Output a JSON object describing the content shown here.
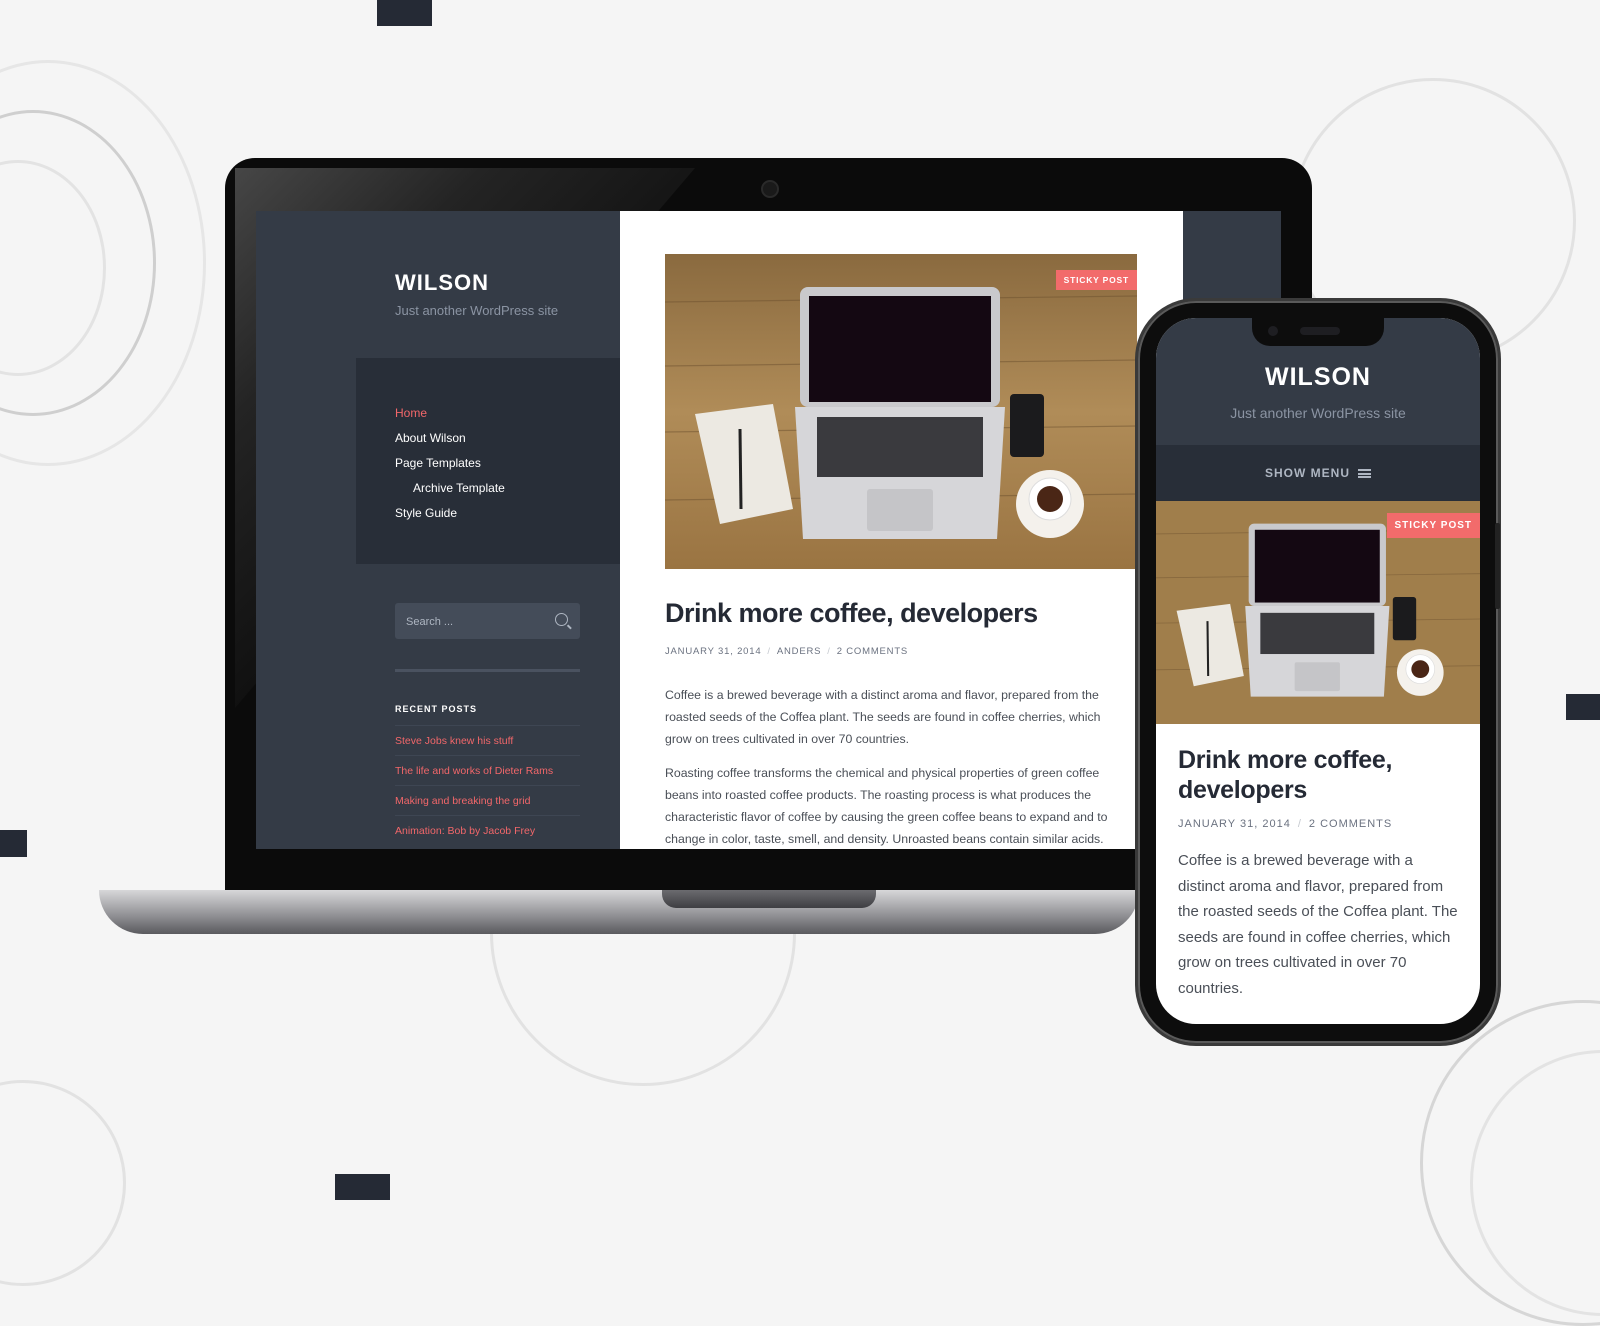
{
  "site": {
    "title": "WILSON",
    "description": "Just another WordPress site"
  },
  "colors": {
    "accent": "#f2676a",
    "sidebar_bg": "#343b46",
    "nav_bg": "#282e38",
    "title_text": "#252a35"
  },
  "laptop": {
    "nav": [
      {
        "label": "Home",
        "active": true,
        "level": 0
      },
      {
        "label": "About Wilson",
        "active": false,
        "level": 0
      },
      {
        "label": "Page Templates",
        "active": false,
        "level": 0
      },
      {
        "label": "Archive Template",
        "active": false,
        "level": 1
      },
      {
        "label": "Style Guide",
        "active": false,
        "level": 0
      }
    ],
    "search": {
      "placeholder": "Search ...",
      "icon": "search-icon"
    },
    "recent_posts": {
      "title": "RECENT POSTS",
      "items": [
        "Steve Jobs knew his stuff",
        "The life and works of Dieter Rams",
        "Making and breaking the grid",
        "Animation: Bob by Jacob Frey"
      ]
    },
    "post": {
      "badge": "STICKY POST",
      "title": "Drink more coffee, developers",
      "meta": {
        "date": "JANUARY 31, 2014",
        "author": "ANDERS",
        "comments": "2 COMMENTS"
      },
      "paragraphs": [
        "Coffee is a brewed beverage with a distinct aroma and flavor, prepared from the roasted seeds of the Coffea plant. The seeds are found in coffee cherries, which grow on trees cultivated in over 70 countries.",
        "Roasting coffee transforms the chemical and physical properties of green coffee beans into roasted coffee products. The roasting process is what produces the characteristic flavor of coffee by causing the green coffee beans to expand and to change in color, taste, smell, and density. Unroasted beans contain similar acids."
      ]
    }
  },
  "phone": {
    "menu_label": "SHOW MENU",
    "menu_icon": "hamburger-icon",
    "post": {
      "badge": "STICKY POST",
      "title": "Drink more coffee, developers",
      "meta": {
        "date": "JANUARY 31, 2014",
        "comments": "2 COMMENTS"
      },
      "body": "Coffee is a brewed beverage with a distinct aroma and flavor, prepared from the roasted seeds of the Coffea plant. The seeds are found in coffee cherries, which grow on trees cultivated in over 70 countries."
    }
  }
}
